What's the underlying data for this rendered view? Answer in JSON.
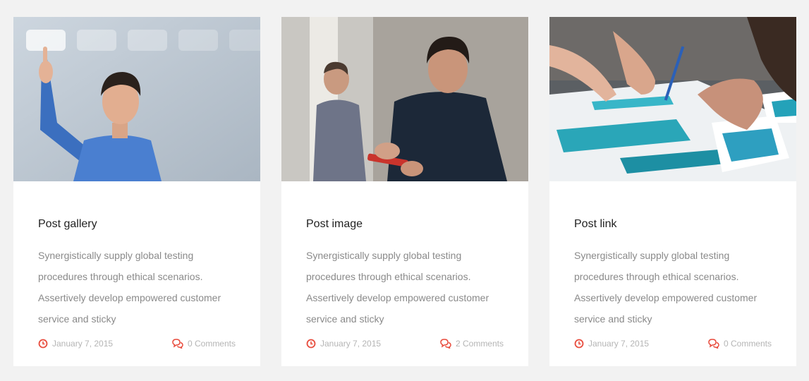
{
  "accent_color": "#e84c3d",
  "posts": [
    {
      "title": "Post gallery",
      "excerpt": "Synergistically supply global testing procedures through ethical scenarios. Assertively develop empowered customer service and sticky",
      "date": "January 7, 2015",
      "comments": "0 Comments",
      "image": "man-in-blue-shirt-touching-screen"
    },
    {
      "title": "Post image",
      "excerpt": "Synergistically supply global testing procedures through ethical scenarios. Assertively develop empowered customer service and sticky",
      "date": "January 7, 2015",
      "comments": "2 Comments",
      "image": "man-using-smartphone-in-hallway"
    },
    {
      "title": "Post link",
      "excerpt": "Synergistically supply global testing procedures through ethical scenarios. Assertively develop empowered customer service and sticky",
      "date": "January 7, 2015",
      "comments": "0 Comments",
      "image": "hands-signing-documents"
    }
  ]
}
